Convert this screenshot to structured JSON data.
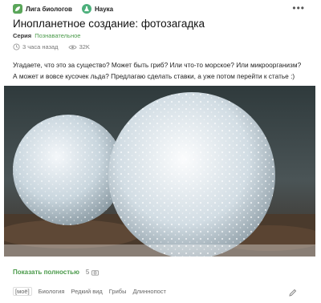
{
  "header": {
    "community_name": "Лига биологов",
    "section_name": "Наука",
    "more_glyph": "•••"
  },
  "post": {
    "title": "Инопланетное создание: фотозагадка",
    "series_label": "Серия",
    "series_name": "Познавательное",
    "time_ago": "3 часа назад",
    "views": "32K",
    "text": "Угадаете, что это за существо? Может быть гриб? Или что-то морское? Или микроорганизм? А может и вовсе кусочек льда? Предлагаю сделать ставки, а уже потом перейти к статье :)"
  },
  "footer": {
    "show_more_label": "Показать полностью",
    "photo_count": "5",
    "tags": [
      "[моё]",
      "Биология",
      "Редкий вид",
      "Грибы",
      "Длиннопост"
    ]
  },
  "colors": {
    "accent": "#4a9a4a",
    "muted": "#777777"
  }
}
